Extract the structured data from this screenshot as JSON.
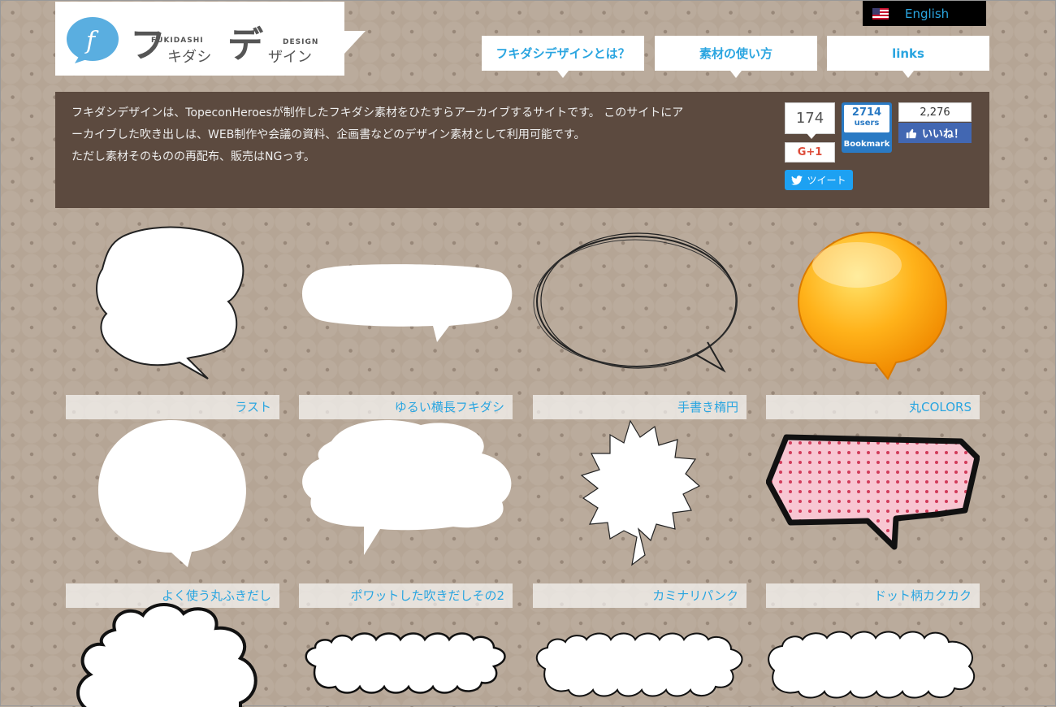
{
  "header": {
    "logo_main_1": "フ",
    "logo_main_2": "キダシ",
    "logo_main_3": "デ",
    "logo_main_4": "ザイン",
    "logo_sub_1": "FUKIDASHI",
    "logo_sub_2": "DESIGN",
    "lang_label": "English"
  },
  "nav": [
    {
      "label": "フキダシデザインとは？"
    },
    {
      "label": "素材の使い方"
    },
    {
      "label": "links"
    }
  ],
  "intro": {
    "line1": "フキダシデザインは、TopeconHeroesが制作したフキダシ素材をひたすらアーカイブするサイトです。 このサイトにア",
    "line2": "ーカイブした吹き出しは、WEB制作や会議の資料、企画書などのデザイン素材として利用可能です。",
    "line3": "ただし素材そのものの再配布、販売はNGっす。"
  },
  "social": {
    "share_count": "174",
    "gplus_label": "G+1",
    "tweet_label": "ツイート",
    "hatena_count": "2714",
    "hatena_unit": "users",
    "hatena_label": "Bookmark",
    "fb_count": "2,276",
    "fb_label": "いいね！"
  },
  "items": [
    {
      "caption": "ラスト"
    },
    {
      "caption": "ゆるい横長フキダシ"
    },
    {
      "caption": "手書き楕円"
    },
    {
      "caption": "丸COLORS"
    },
    {
      "caption": "よく使う丸ふきだし"
    },
    {
      "caption": "ポワットした吹きだしその2"
    },
    {
      "caption": "カミナリパンク"
    },
    {
      "caption": "ドット柄カクカク"
    }
  ],
  "colors": {
    "accent": "#2aa5e0",
    "intro_bg": "#5c4a3f",
    "page_bg": "#b5a595"
  }
}
